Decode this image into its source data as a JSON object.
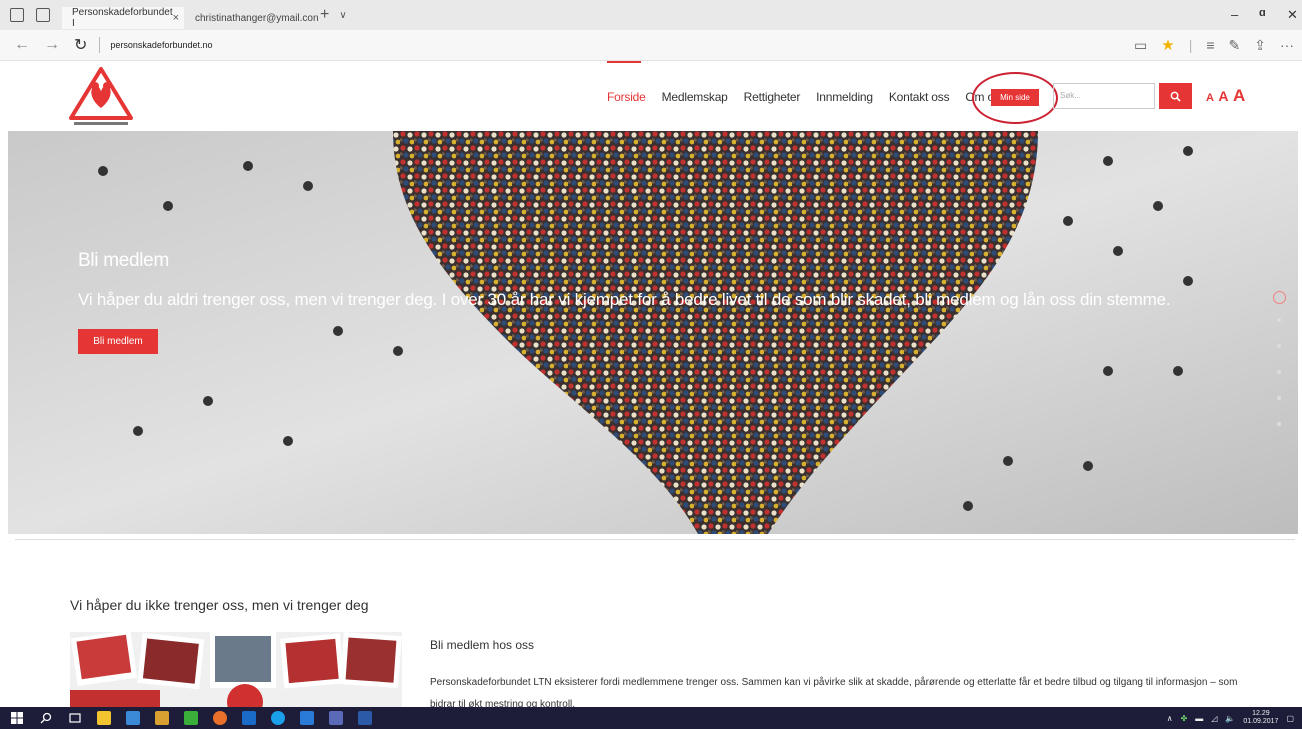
{
  "browser": {
    "tabs": [
      {
        "label": "Personskadeforbundet I",
        "active": true
      },
      {
        "label": "christinathanger@ymail.con",
        "active": false
      }
    ],
    "new_tab": "+",
    "tab_close": "×",
    "url": "personskadeforbundet.no",
    "window": {
      "minimize": "–",
      "maximize": "ɑ",
      "close": "✕"
    }
  },
  "site": {
    "menu": [
      {
        "label": "Forside",
        "active": true
      },
      {
        "label": "Medlemskap"
      },
      {
        "label": "Rettigheter"
      },
      {
        "label": "Innmelding"
      },
      {
        "label": "Kontakt oss"
      },
      {
        "label": "Om oss"
      }
    ],
    "min_side": "Min side",
    "search_placeholder": "Søk...",
    "font_size_letters": [
      "A",
      "A",
      "A"
    ],
    "accent_color": "#e53535"
  },
  "hero": {
    "title": "Bli medlem",
    "text": "Vi håper du aldri trenger oss, men vi trenger deg. I over 30 år har vi kjempet for å bedre livet til de som blir skadet, bli medlem og lån oss din stemme.",
    "button": "Bli medlem"
  },
  "content": {
    "section_title": "Vi håper du ikke trenger oss, men vi trenger deg",
    "subheading": "Bli medlem hos oss",
    "body": "Personskadeforbundet LTN eksisterer fordi medlemmene trenger oss. Sammen kan vi påvirke slik at skadde, pårørende og etterlatte får et bedre tilbud og tilgang til informasjon – som bidrar til økt mestring og kontroll."
  },
  "taskbar": {
    "time": "12.29",
    "date": "01.09.2017"
  }
}
